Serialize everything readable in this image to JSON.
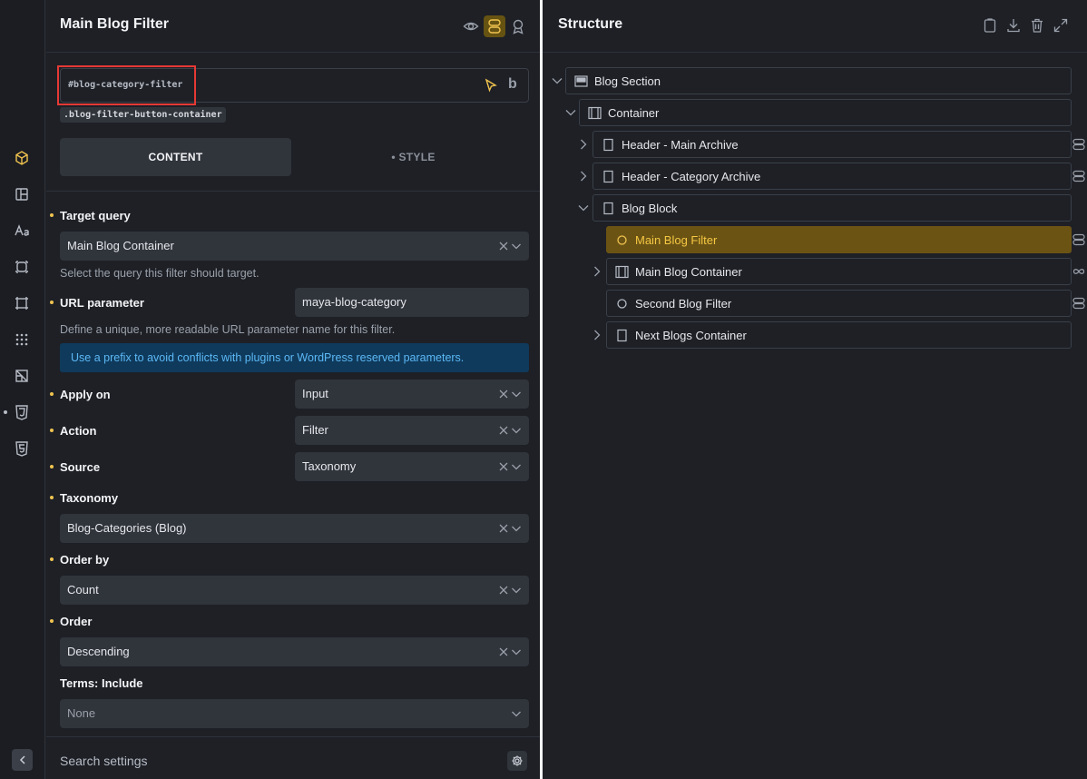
{
  "settings": {
    "title": "Main Blog Filter",
    "element_id": "#blog-category-filter",
    "element_class": ".blog-filter-button-container",
    "tabs": {
      "content": "CONTENT",
      "style": "• STYLE"
    },
    "target_query": {
      "label": "Target query",
      "value": "Main Blog Container",
      "help": "Select the query this filter should target."
    },
    "url_parameter": {
      "label": "URL parameter",
      "value": "maya-blog-category",
      "help": "Define a unique, more readable URL parameter name for this filter.",
      "info": "Use a prefix to avoid conflicts with plugins or WordPress reserved parameters."
    },
    "apply_on": {
      "label": "Apply on",
      "value": "Input"
    },
    "action": {
      "label": "Action",
      "value": "Filter"
    },
    "source": {
      "label": "Source",
      "value": "Taxonomy"
    },
    "taxonomy": {
      "label": "Taxonomy",
      "value": "Blog-Categories (Blog)"
    },
    "order_by": {
      "label": "Order by",
      "value": "Count"
    },
    "order": {
      "label": "Order",
      "value": "Descending"
    },
    "terms_include": {
      "label": "Terms: Include",
      "value": "None"
    },
    "search_placeholder": "Search settings"
  },
  "structure": {
    "title": "Structure",
    "nodes": [
      {
        "label": "Blog Section"
      },
      {
        "label": "Container"
      },
      {
        "label": "Header - Main Archive"
      },
      {
        "label": "Header - Category Archive"
      },
      {
        "label": "Blog Block"
      },
      {
        "label": "Main Blog Filter"
      },
      {
        "label": "Main Blog Container"
      },
      {
        "label": "Second Blog Filter"
      },
      {
        "label": "Next Blogs Container"
      }
    ]
  },
  "colors": {
    "accent": "#f0c34f",
    "selected_row": "#6b5314",
    "info_background": "#0f3a5c",
    "info_text": "#5cb8f5",
    "highlight_box": "#e53935"
  },
  "icons": {
    "rail": [
      "cube-icon",
      "layout-icon",
      "typography-icon",
      "element-icon",
      "frame-icon",
      "grid-icon",
      "wireframe-icon",
      "css3-icon",
      "html5-icon"
    ],
    "settings_header": [
      "eye-icon",
      "toggle-icon",
      "award-icon"
    ],
    "structure_header": [
      "clipboard-icon",
      "download-icon",
      "trash-icon",
      "expand-icon"
    ]
  }
}
